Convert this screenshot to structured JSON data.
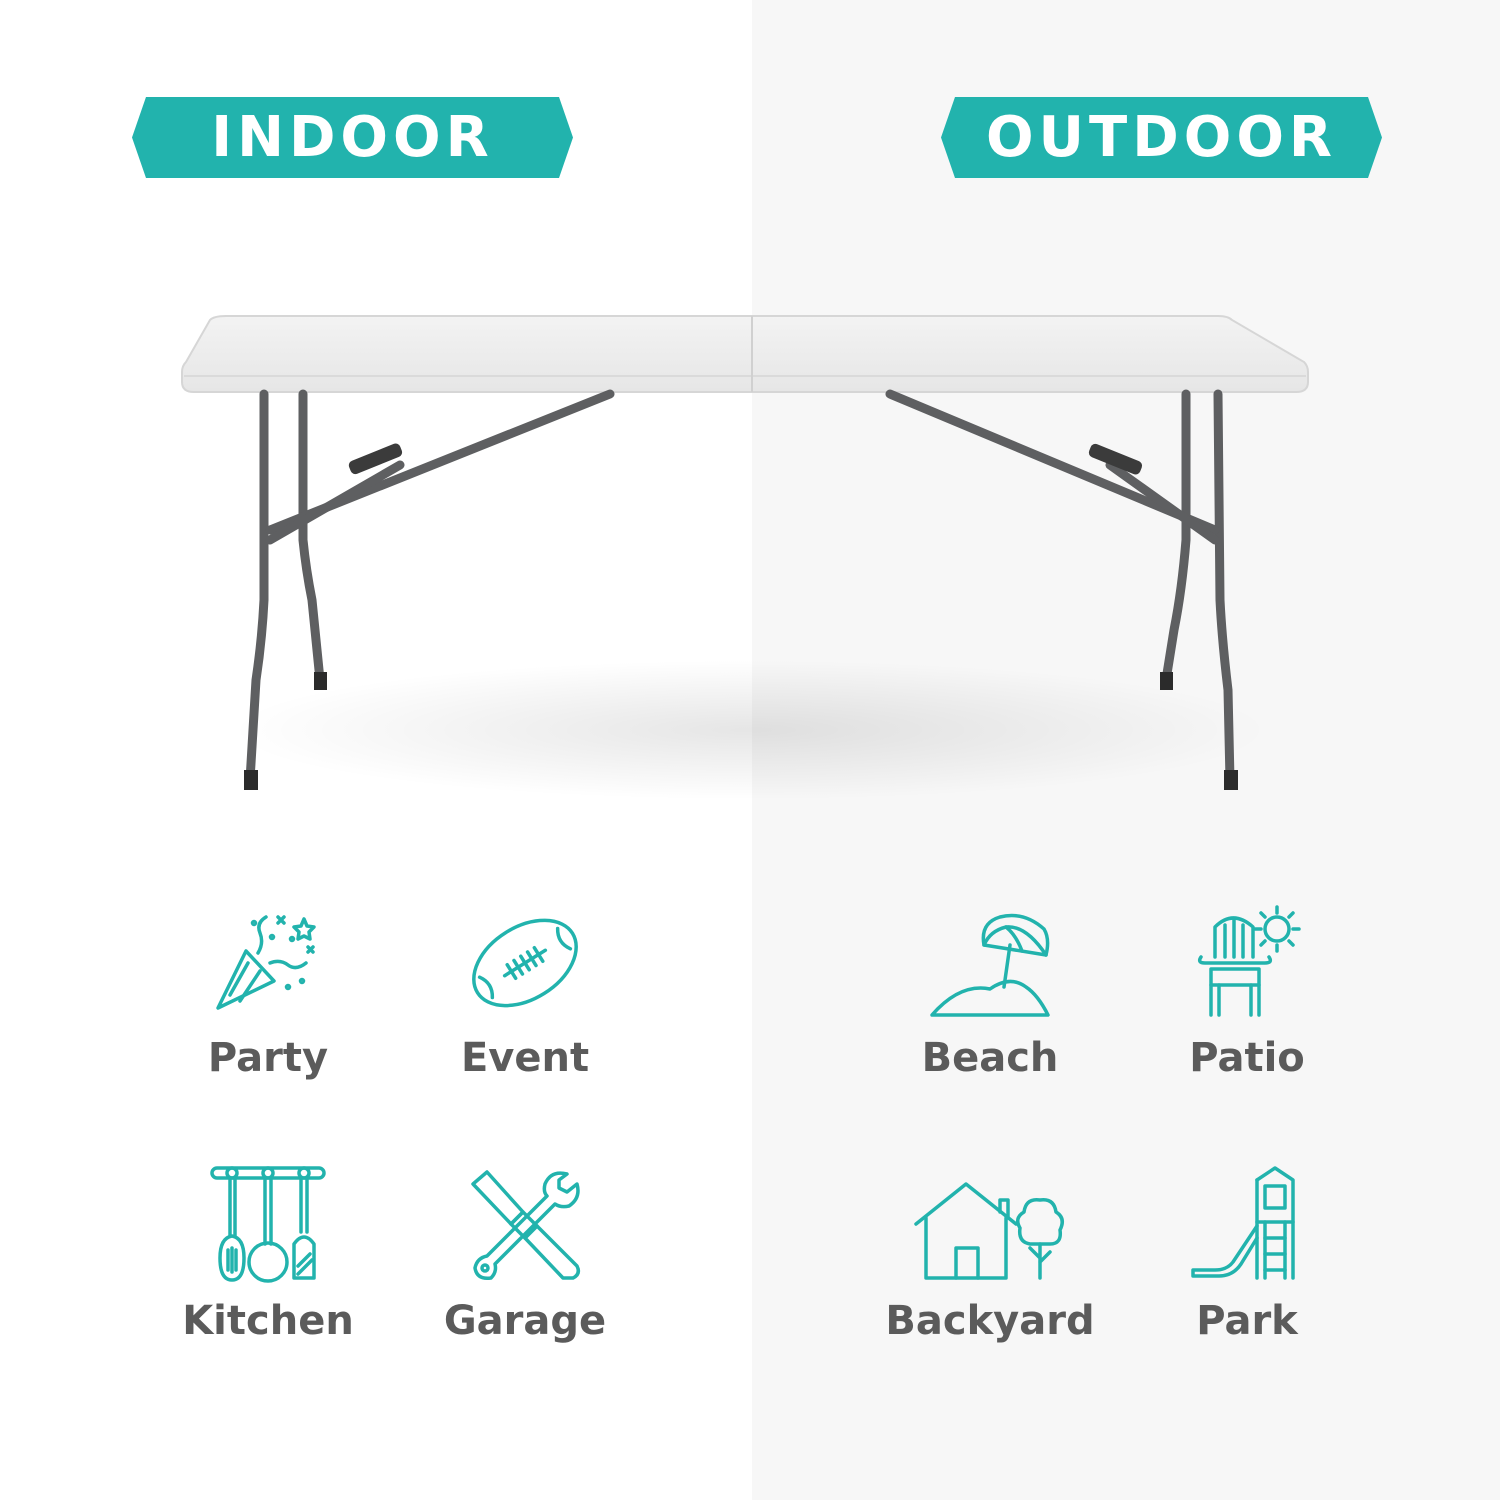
{
  "colors": {
    "accent": "#22b3ad",
    "label_text": "#5b5b5b",
    "right_panel": "#f7f7f7",
    "left_panel": "#ffffff"
  },
  "banners": {
    "indoor": "INDOOR",
    "outdoor": "OUTDOOR"
  },
  "indoor": [
    {
      "label": "Party",
      "icon": "party-popper-icon"
    },
    {
      "label": "Event",
      "icon": "football-icon"
    },
    {
      "label": "Kitchen",
      "icon": "kitchen-utensils-icon"
    },
    {
      "label": "Garage",
      "icon": "wrench-screwdriver-icon"
    }
  ],
  "outdoor": [
    {
      "label": "Beach",
      "icon": "beach-umbrella-icon"
    },
    {
      "label": "Patio",
      "icon": "patio-chair-icon"
    },
    {
      "label": "Backyard",
      "icon": "house-tree-icon"
    },
    {
      "label": "Park",
      "icon": "playground-slide-icon"
    }
  ]
}
